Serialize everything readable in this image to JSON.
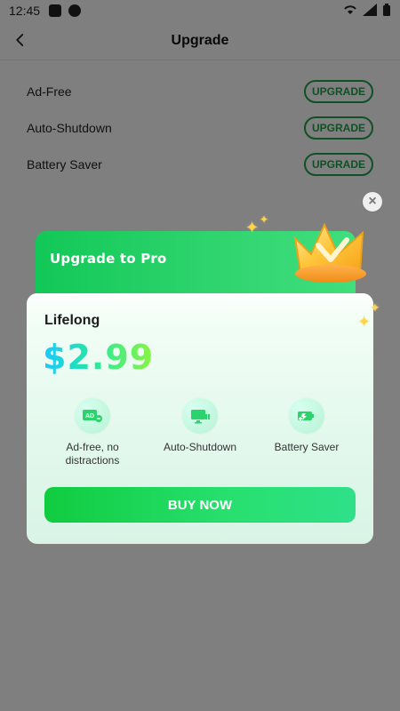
{
  "status_bar": {
    "time": "12:45"
  },
  "app_bar": {
    "title": "Upgrade",
    "back_icon": "chevron-left-icon"
  },
  "list": {
    "items": [
      {
        "label": "Ad-Free",
        "action": "UPGRADE"
      },
      {
        "label": "Auto-Shutdown",
        "action": "UPGRADE"
      },
      {
        "label": "Battery Saver",
        "action": "UPGRADE"
      }
    ]
  },
  "modal": {
    "header_title": "Upgrade to Pro",
    "plan": "Lifelong",
    "price": "$2.99",
    "features": [
      {
        "label": "Ad-free, no distractions",
        "icon": "ad-free-icon"
      },
      {
        "label": "Auto-Shutdown",
        "icon": "monitor-pause-icon"
      },
      {
        "label": "Battery Saver",
        "icon": "battery-saver-icon"
      }
    ],
    "cta": "BUY NOW",
    "close_icon": "close-icon",
    "crown_icon": "crown-icon",
    "sparkle_icon": "sparkle-icon",
    "colors": {
      "brand_green": "#1ea24a",
      "header_gradient_start": "#12c857",
      "header_gradient_end": "#40de7d",
      "price_gradient_start": "#19c8ff",
      "price_gradient_end": "#8bf540"
    }
  }
}
